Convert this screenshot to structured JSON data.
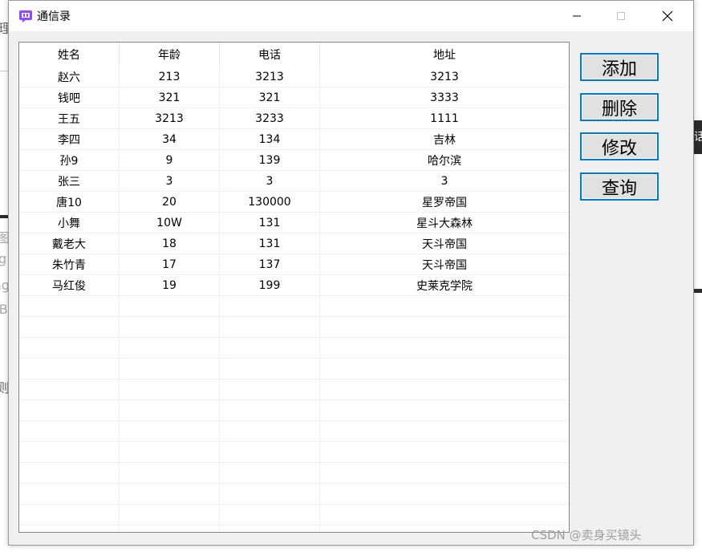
{
  "window": {
    "title": "通信录",
    "accent_color": "#0078d7"
  },
  "titlebar_buttons": {
    "minimize_icon": "minimize-icon",
    "maximize_icon": "maximize-icon",
    "close_icon": "close-icon"
  },
  "table": {
    "columns": [
      "姓名",
      "年龄",
      "电话",
      "地址"
    ],
    "rows": [
      [
        "赵六",
        "213",
        "3213",
        "3213"
      ],
      [
        "钱吧",
        "321",
        "321",
        "3333"
      ],
      [
        "王五",
        "3213",
        "3233",
        "1111"
      ],
      [
        "李四",
        "34",
        "134",
        "吉林"
      ],
      [
        "孙9",
        "9",
        "139",
        "哈尔滨"
      ],
      [
        "张三",
        "3",
        "3",
        "3"
      ],
      [
        "唐10",
        "20",
        "130000",
        "星罗帝国"
      ],
      [
        "小舞",
        "10W",
        "131",
        "星斗大森林"
      ],
      [
        "戴老大",
        "18",
        "131",
        "天斗帝国"
      ],
      [
        "朱竹青",
        "17",
        "137",
        "天斗帝国"
      ],
      [
        "马红俊",
        "19",
        "199",
        "史莱克学院"
      ]
    ]
  },
  "buttons": {
    "add": "添加",
    "delete": "删除",
    "edit": "修改",
    "query": "查询"
  },
  "background": {
    "frag1": "理",
    "frag2": "图",
    "frag3": "g",
    "frag4": "ag",
    "frag5": "IB",
    "frag6": "则",
    "frag7": "话"
  },
  "watermark": "CSDN @卖身买镜头"
}
